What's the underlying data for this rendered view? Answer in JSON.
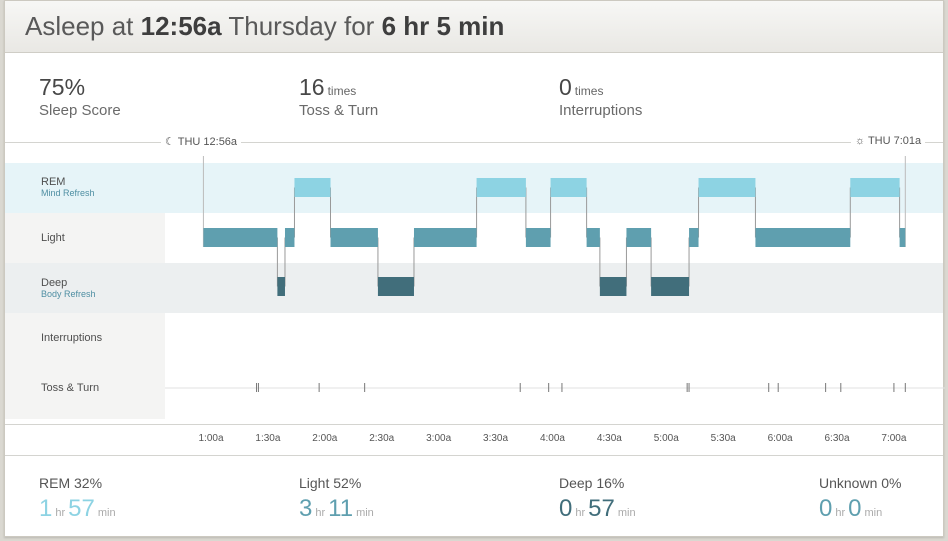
{
  "header": {
    "prefix": "Asleep at",
    "time": "12:56a",
    "day": "Thursday",
    "for": "for",
    "duration": "6 hr 5 min"
  },
  "stats": [
    {
      "value": "75%",
      "unit": "",
      "label": "Sleep Score"
    },
    {
      "value": "16",
      "unit": "times",
      "label": "Toss & Turn"
    },
    {
      "value": "0",
      "unit": "times",
      "label": "Interruptions"
    }
  ],
  "timeline": {
    "start_label": "THU 12:56a",
    "end_label": "THU 7:01a",
    "start_icon": "moon-icon",
    "end_icon": "sun-icon"
  },
  "lanes": [
    {
      "label": "REM",
      "sub": "Mind Refresh"
    },
    {
      "label": "Light",
      "sub": ""
    },
    {
      "label": "Deep",
      "sub": "Body Refresh"
    },
    {
      "label": "Interruptions",
      "sub": ""
    },
    {
      "label": "Toss & Turn",
      "sub": ""
    }
  ],
  "axis_ticks": [
    "1:00a",
    "1:30a",
    "2:00a",
    "2:30a",
    "3:00a",
    "3:30a",
    "4:00a",
    "4:30a",
    "5:00a",
    "5:30a",
    "6:00a",
    "6:30a",
    "7:00a"
  ],
  "colors": {
    "rem": "#8dd3e3",
    "light": "#5f9faf",
    "deep": "#416e7b",
    "rem_band": "#e6f4f8",
    "deep_band": "#eceff0",
    "text": "#555555"
  },
  "hypnogram": [
    {
      "stage": "light",
      "start_min": 56,
      "end_min": 95
    },
    {
      "stage": "deep",
      "start_min": 95,
      "end_min": 99
    },
    {
      "stage": "light",
      "start_min": 99,
      "end_min": 104
    },
    {
      "stage": "rem",
      "start_min": 104,
      "end_min": 123
    },
    {
      "stage": "light",
      "start_min": 123,
      "end_min": 148
    },
    {
      "stage": "deep",
      "start_min": 148,
      "end_min": 167
    },
    {
      "stage": "light",
      "start_min": 167,
      "end_min": 200
    },
    {
      "stage": "rem",
      "start_min": 200,
      "end_min": 226
    },
    {
      "stage": "light",
      "start_min": 226,
      "end_min": 239
    },
    {
      "stage": "rem",
      "start_min": 239,
      "end_min": 258
    },
    {
      "stage": "light",
      "start_min": 258,
      "end_min": 265
    },
    {
      "stage": "deep",
      "start_min": 265,
      "end_min": 279
    },
    {
      "stage": "light",
      "start_min": 279,
      "end_min": 292
    },
    {
      "stage": "deep",
      "start_min": 292,
      "end_min": 312
    },
    {
      "stage": "light",
      "start_min": 312,
      "end_min": 317
    },
    {
      "stage": "rem",
      "start_min": 317,
      "end_min": 347
    },
    {
      "stage": "light",
      "start_min": 347,
      "end_min": 397
    },
    {
      "stage": "rem",
      "start_min": 397,
      "end_min": 423
    },
    {
      "stage": "light",
      "start_min": 423,
      "end_min": 426
    }
  ],
  "toss_turn_min": [
    84,
    85,
    117,
    141,
    223,
    238,
    245,
    311,
    312,
    354,
    359,
    384,
    392,
    420,
    426
  ],
  "summary": [
    {
      "label": "REM 32%",
      "hr": "1",
      "min": "57",
      "color": "#8dd3e3"
    },
    {
      "label": "Light 52%",
      "hr": "3",
      "min": "11",
      "color": "#5f9faf"
    },
    {
      "label": "Deep 16%",
      "hr": "0",
      "min": "57",
      "color": "#416e7b"
    },
    {
      "label": "Unknown 0%",
      "hr": "0",
      "min": "0",
      "color": "#5f9faf"
    }
  ],
  "summary_units": {
    "hr": "hr",
    "min": "min"
  }
}
